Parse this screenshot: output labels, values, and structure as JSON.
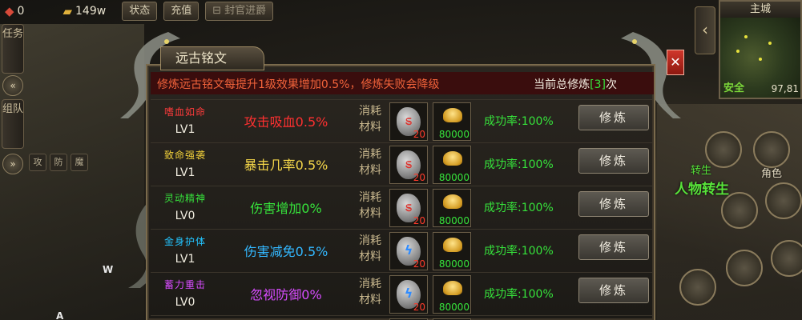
{
  "topbar": {
    "gems": "0",
    "gold": "149w",
    "status_btn": "状态",
    "recharge_btn": "充值",
    "title_btn": "封官进爵"
  },
  "left_tabs": {
    "task": "任务",
    "team": "组队",
    "mini_tools": [
      "攻",
      "防",
      "魔"
    ]
  },
  "minimap": {
    "title": "主城",
    "safe": "安全",
    "coord": "97,81"
  },
  "right_buttons": {
    "transfer": "人物转生",
    "role": "角色",
    "label_2": "转生"
  },
  "dialog": {
    "title": "远古铭文",
    "info": "修炼远古铭文每提升1级效果增加0.5%，修炼失败会降级",
    "total_prefix": "当前总修炼",
    "total_count": "[3]",
    "total_suffix": "次",
    "consume_label_1": "消耗",
    "consume_label_2": "材料",
    "rows": [
      {
        "name": "嗜血如命",
        "level": "LV1",
        "effect": "攻击吸血0.5%",
        "rune_qty": "20",
        "gold_qty": "80000",
        "rate": "成功率:100%",
        "button": "修炼"
      },
      {
        "name": "致命强袭",
        "level": "LV1",
        "effect": "暴击几率0.5%",
        "rune_qty": "20",
        "gold_qty": "80000",
        "rate": "成功率:100%",
        "button": "修炼"
      },
      {
        "name": "灵动精神",
        "level": "LV0",
        "effect": "伤害增加0%",
        "rune_qty": "20",
        "gold_qty": "80000",
        "rate": "成功率:100%",
        "button": "修炼"
      },
      {
        "name": "金身护体",
        "level": "LV1",
        "effect": "伤害减免0.5%",
        "rune_qty": "20",
        "gold_qty": "80000",
        "rate": "成功率:100%",
        "button": "修炼"
      },
      {
        "name": "蓄力重击",
        "level": "LV0",
        "effect": "忽视防御0%",
        "rune_qty": "20",
        "gold_qty": "80000",
        "rate": "成功率:100%",
        "button": "修炼"
      }
    ]
  },
  "hud": {
    "w": "W",
    "a": "A"
  },
  "colors": {
    "row0_name": "#ff3b3b",
    "row0_effect": "#ff3030",
    "row1_name": "#f3d23a",
    "row1_effect": "#f6d84a",
    "row2_name": "#36e33b",
    "row2_effect": "#36e33b",
    "row3_name": "#22c4ff",
    "row3_effect": "#33b8ff",
    "row4_name": "#d84cff",
    "row4_effect": "#d84cff"
  }
}
